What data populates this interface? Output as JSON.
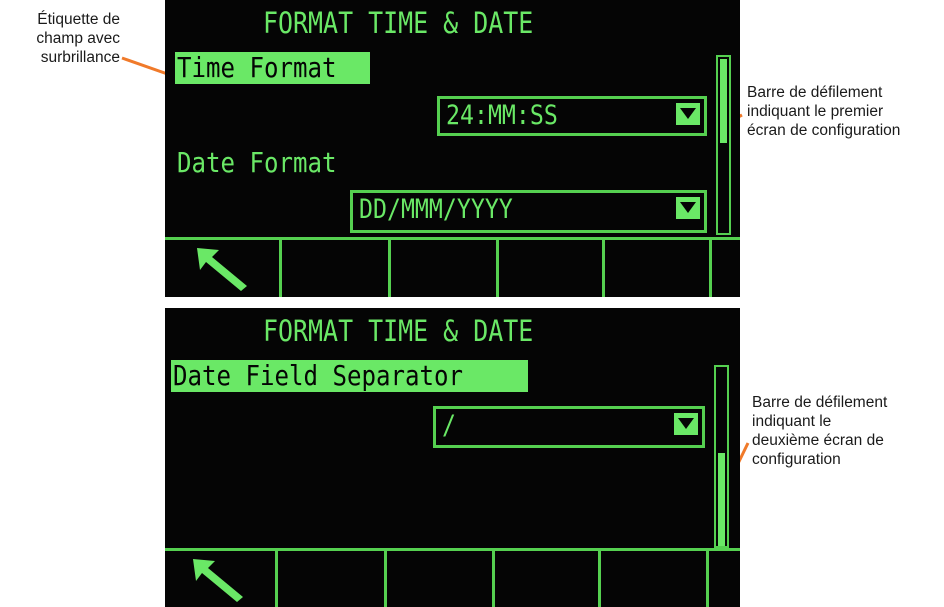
{
  "callouts": {
    "field_label": {
      "line1": "Étiquette de",
      "line2": "champ avec",
      "line3": "surbrillance"
    },
    "scrollbar_first": {
      "line1": "Barre de défilement",
      "line2": "indiquant le premier",
      "line3": "écran de configuration"
    },
    "scrollbar_second": {
      "line1": "Barre de défilement",
      "line2": "indiquant le",
      "line3": "deuxième écran de",
      "line4": "configuration"
    }
  },
  "screen1": {
    "title": "FORMAT TIME & DATE",
    "field1_label": "Time Format",
    "field1_value": "24:MM:SS",
    "field2_label": "Date Format",
    "field2_value": "DD/MMM/YYYY",
    "scroll_page": 1,
    "scroll_pages": 2
  },
  "screen2": {
    "title": "FORMAT TIME & DATE",
    "field1_label": "Date Field Separator",
    "field1_value": "/",
    "scroll_page": 2,
    "scroll_pages": 2
  },
  "softkeys": {
    "first_key_icon": "back-arrow-icon",
    "dropdown_icon": "triangle-down-icon"
  },
  "colors": {
    "lcd_green": "#6ae866",
    "lcd_background": "#050505",
    "callout_leader": "#f07a2a"
  }
}
